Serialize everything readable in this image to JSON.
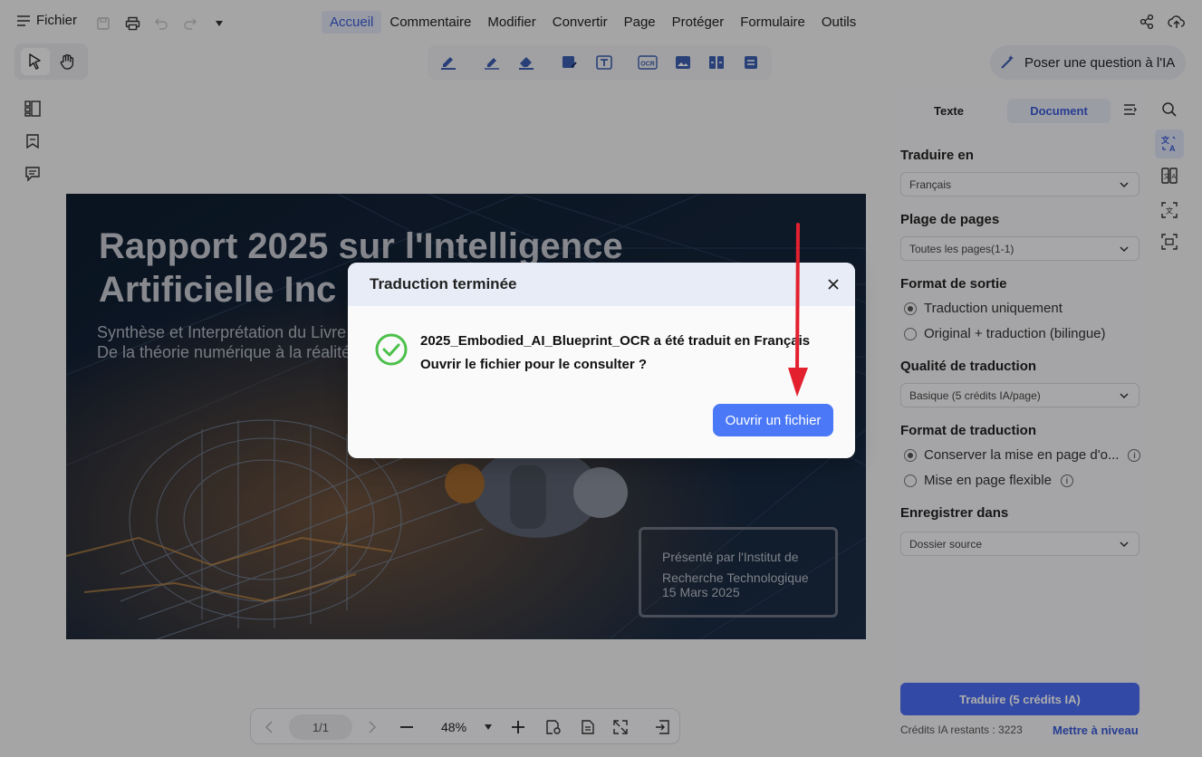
{
  "menubar": {
    "file_label": "Fichier",
    "tabs": [
      "Accueil",
      "Commentaire",
      "Modifier",
      "Convertir",
      "Page",
      "Protéger",
      "Formulaire",
      "Outils"
    ],
    "active_tab": "Accueil"
  },
  "ask_ai": {
    "label": "Poser une question à l'IA"
  },
  "document": {
    "title": "Rapport 2025 sur l'Intelligence\nArtificielle Inc",
    "subtitle": "Synthèse et Interprétation du Livre\nDe la théorie numérique à la réalité",
    "presented_by": "Présenté par l'Institut de\nRecherche Technologique",
    "date": "15 Mars 2025"
  },
  "dialog": {
    "title": "Traduction terminée",
    "message_line1": "2025_Embodied_AI_Blueprint_OCR a été traduit en Français",
    "message_line2": "Ouvrir le fichier pour le consulter ?",
    "open_button": "Ouvrir un fichier"
  },
  "right_panel": {
    "tab_text": "Texte",
    "tab_document": "Document",
    "translate_to_label": "Traduire en",
    "translate_to_value": "Français",
    "page_range_label": "Plage de pages",
    "page_range_value": "Toutes les pages(1-1)",
    "output_format_label": "Format de sortie",
    "output_option1": "Traduction uniquement",
    "output_option2": "Original + traduction (bilingue)",
    "quality_label": "Qualité de traduction",
    "quality_value": "Basique (5 crédits IA/page)",
    "translation_format_label": "Format de traduction",
    "format_option1": "Conserver la mise en page d'o...",
    "format_option2": "Mise en page flexible",
    "save_in_label": "Enregistrer dans",
    "save_in_value": "Dossier source",
    "translate_button": "Traduire (5 crédits IA)",
    "credits_remaining": "Crédits IA restants : 3223",
    "upgrade_link": "Mettre à niveau"
  },
  "bottom_bar": {
    "page": "1/1",
    "zoom": "48%"
  },
  "colors": {
    "accent": "#4a6cf4",
    "success": "#4cc04a",
    "annotation_arrow": "#e3202e"
  }
}
